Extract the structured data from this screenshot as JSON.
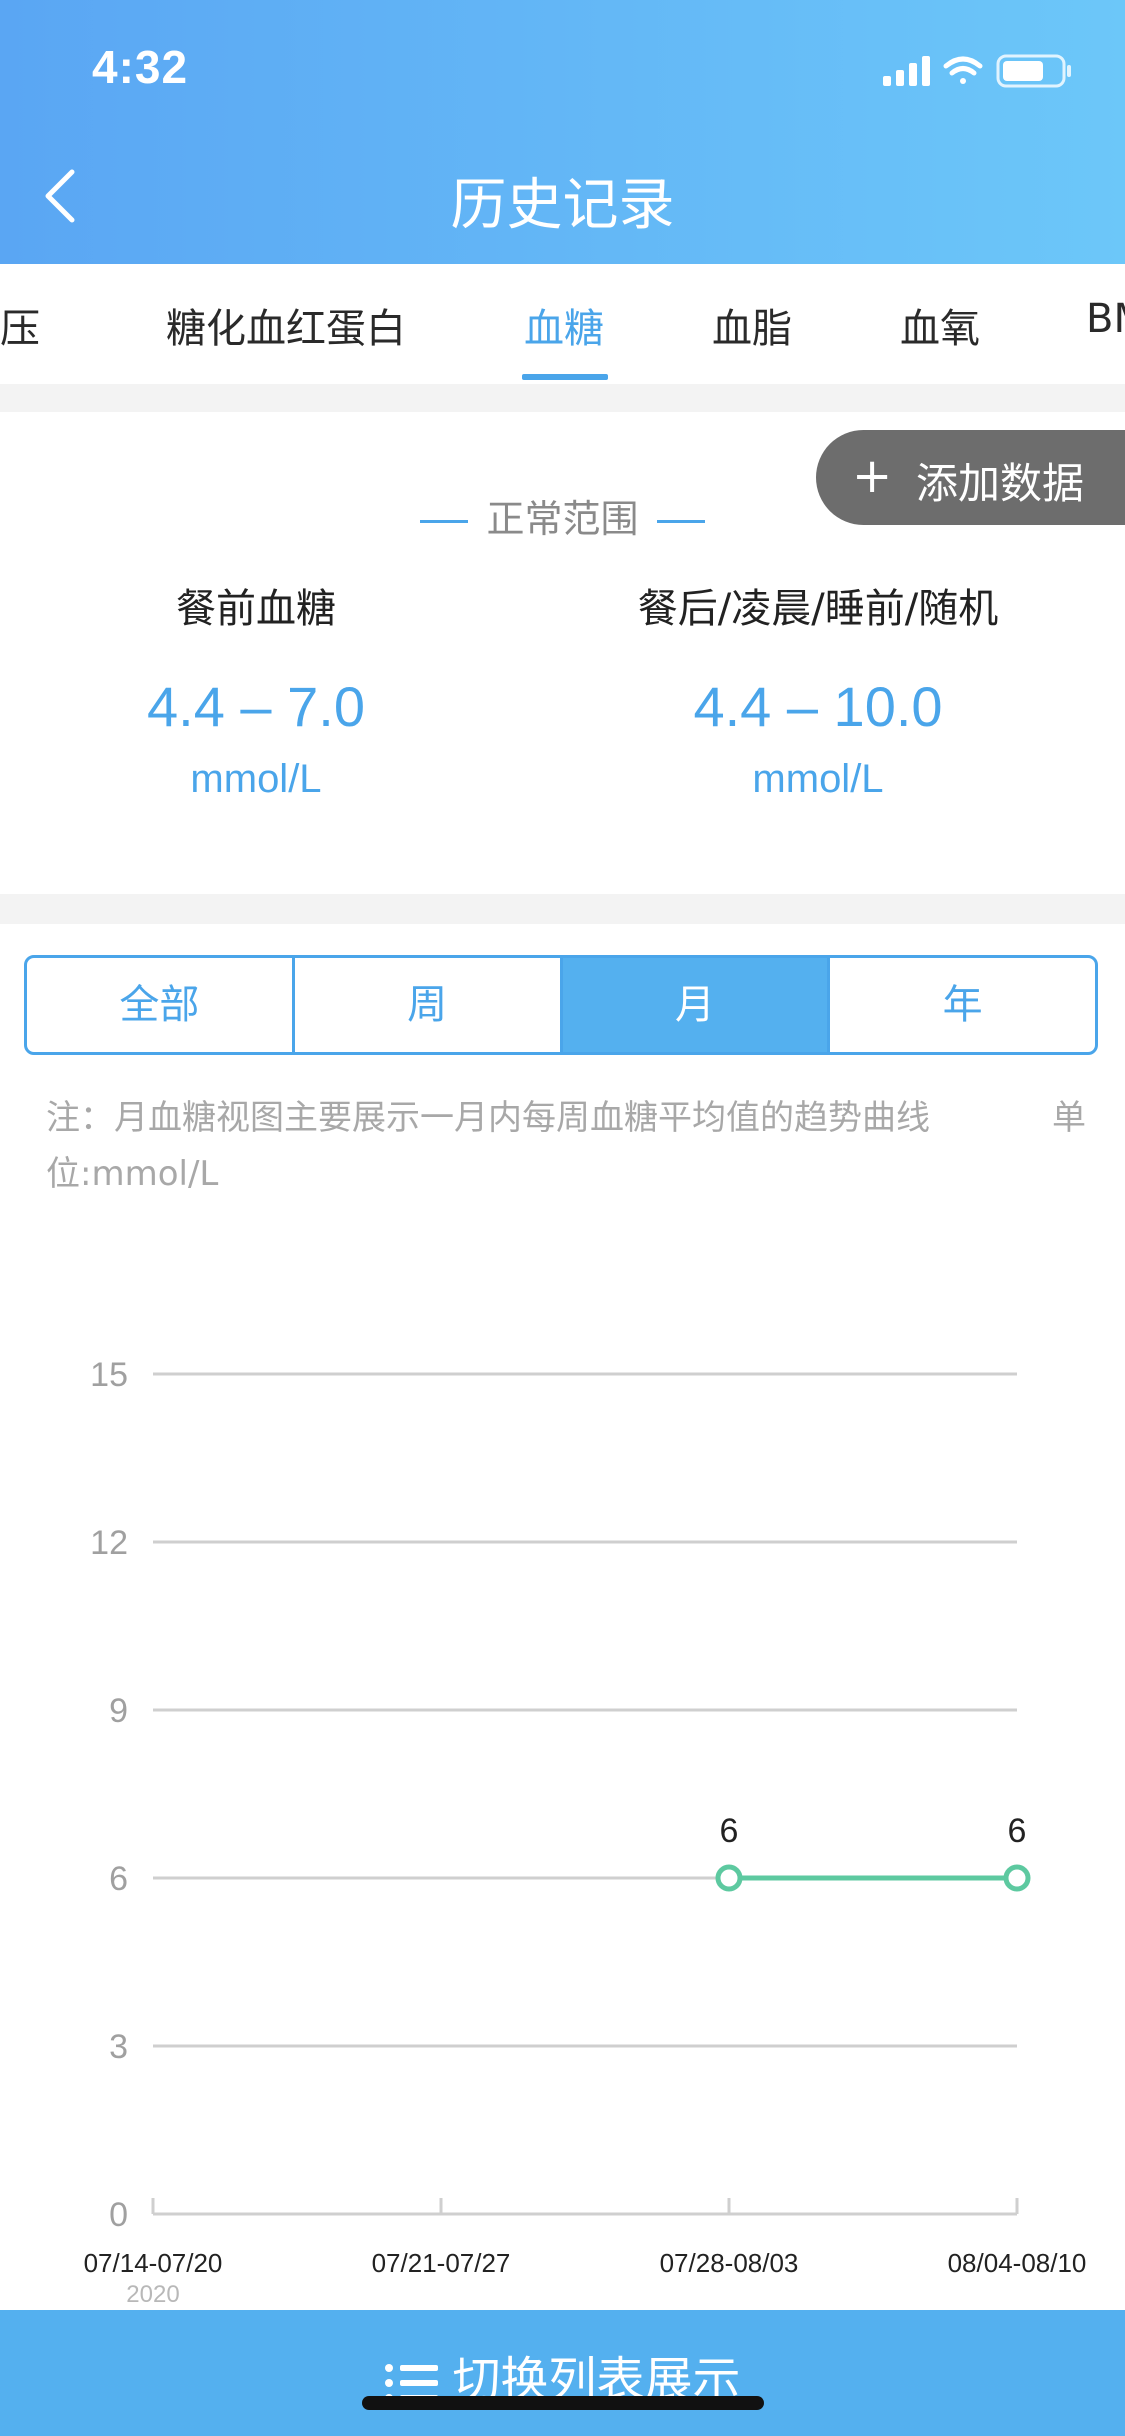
{
  "status": {
    "time": "4:32"
  },
  "header": {
    "title": "历史记录"
  },
  "tabs": [
    {
      "label": "血压",
      "active": false
    },
    {
      "label": "糖化血红蛋白",
      "active": false
    },
    {
      "label": "血糖",
      "active": true
    },
    {
      "label": "血脂",
      "active": false
    },
    {
      "label": "血氧",
      "active": false
    },
    {
      "label": "BMI",
      "active": false
    }
  ],
  "add_button": {
    "plus": "+",
    "label": "添加数据"
  },
  "normal_range": {
    "heading": "正常范围",
    "fasting": {
      "name": "餐前血糖",
      "range": "4.4 – 7.0",
      "unit": "mmol/L"
    },
    "other": {
      "name": "餐后/凌晨/睡前/随机",
      "range": "4.4 – 10.0",
      "unit": "mmol/L"
    }
  },
  "period_tabs": [
    {
      "label": "全部",
      "active": false
    },
    {
      "label": "周",
      "active": false
    },
    {
      "label": "月",
      "active": true
    },
    {
      "label": "年",
      "active": false
    }
  ],
  "note": {
    "text": "注：月血糖视图主要展示一月内每周血糖平均值的趋势曲线",
    "unit_prefix": "单",
    "unit_suffix": "位:mmol/L"
  },
  "chart_data": {
    "type": "line",
    "categories": [
      "07/14-07/20",
      "07/21-07/27",
      "07/28-08/03",
      "08/04-08/10"
    ],
    "year_label": "2020",
    "series": [
      {
        "values": [
          null,
          null,
          6,
          6
        ],
        "color": "#5dc9a0"
      }
    ],
    "y_ticks": [
      0,
      3,
      6,
      9,
      12,
      15
    ],
    "ylim": [
      0,
      15
    ],
    "grid": true
  },
  "footer": {
    "label": "切换列表展示"
  }
}
